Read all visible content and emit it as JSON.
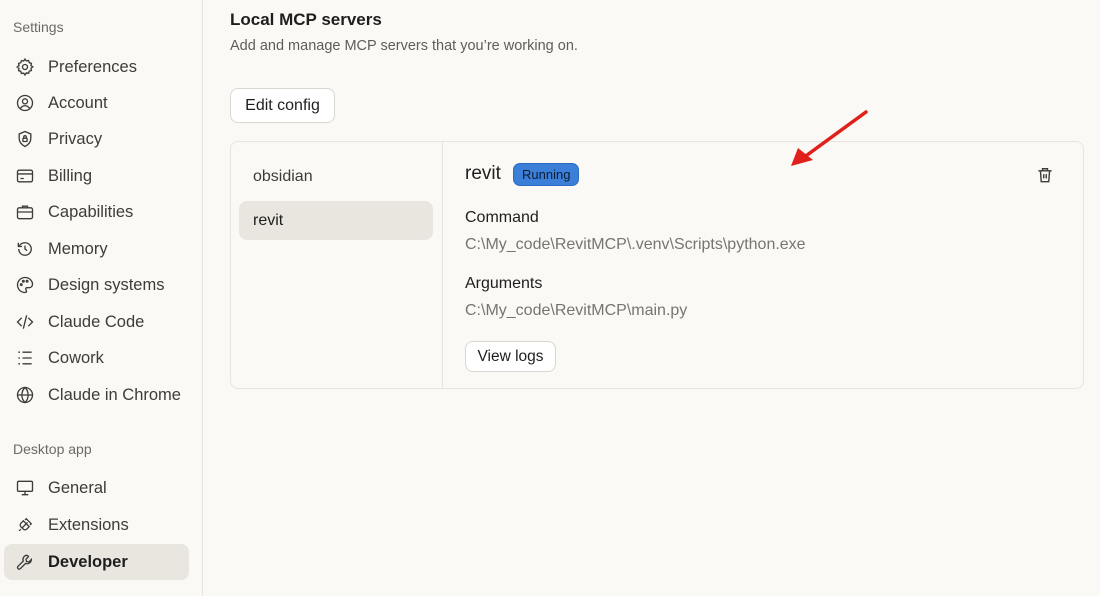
{
  "sidebar": {
    "settings_label": "Settings",
    "desktop_label": "Desktop app",
    "items": [
      {
        "label": "Preferences",
        "icon": "gear-icon"
      },
      {
        "label": "Account",
        "icon": "user-circle-icon"
      },
      {
        "label": "Privacy",
        "icon": "shield-lock-icon"
      },
      {
        "label": "Billing",
        "icon": "credit-card-icon"
      },
      {
        "label": "Capabilities",
        "icon": "briefcase-icon"
      },
      {
        "label": "Memory",
        "icon": "history-icon"
      },
      {
        "label": "Design systems",
        "icon": "palette-icon"
      },
      {
        "label": "Claude Code",
        "icon": "code-icon"
      },
      {
        "label": "Cowork",
        "icon": "list-icon"
      },
      {
        "label": "Claude in Chrome",
        "icon": "globe-icon"
      }
    ],
    "desktop_items": [
      {
        "label": "General",
        "icon": "monitor-icon"
      },
      {
        "label": "Extensions",
        "icon": "plug-icon"
      },
      {
        "label": "Developer",
        "icon": "wrench-icon",
        "active": true
      }
    ]
  },
  "main": {
    "title": "Local MCP servers",
    "subtitle": "Add and manage MCP servers that you’re working on.",
    "edit_config_label": "Edit config",
    "servers": [
      "obsidian",
      "revit"
    ],
    "selected_server": {
      "name": "revit",
      "status": "Running",
      "command_label": "Command",
      "command_value": "C:\\My_code\\RevitMCP\\.venv\\Scripts\\python.exe",
      "arguments_label": "Arguments",
      "arguments_value": "C:\\My_code\\RevitMCP\\main.py",
      "view_logs_label": "View logs"
    }
  },
  "colors": {
    "status_badge": "#3b7fd9",
    "annotation_arrow": "#e0201b"
  }
}
